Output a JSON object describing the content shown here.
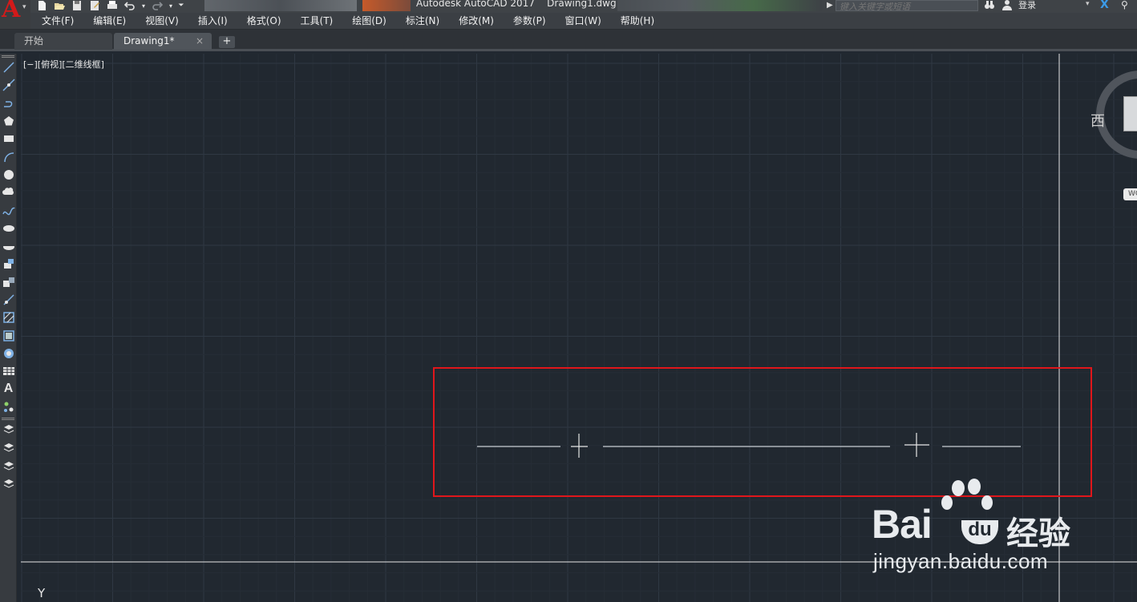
{
  "app": {
    "window_title": "Autodesk AutoCAD 2017    Drawing1.dwg",
    "search_placeholder": "键入关键字或短语",
    "login_label": "登录",
    "icons": [
      "app-logo-icon",
      "new-file-icon",
      "open-file-icon",
      "save-icon",
      "save-as-icon",
      "print-icon",
      "undo-icon",
      "redo-icon",
      "workspace-dropdown-icon",
      "binoculars-icon",
      "user-icon",
      "x-exchange-icon",
      "bookmark-icon"
    ]
  },
  "menu": {
    "items": [
      "文件(F)",
      "编辑(E)",
      "视图(V)",
      "插入(I)",
      "格式(O)",
      "工具(T)",
      "绘图(D)",
      "标注(N)",
      "修改(M)",
      "参数(P)",
      "窗口(W)",
      "帮助(H)"
    ]
  },
  "tabs": {
    "items": [
      {
        "label": "开始",
        "active": false
      },
      {
        "label": "Drawing1*",
        "active": true
      }
    ],
    "close_glyph": "×",
    "new_glyph": "+"
  },
  "toolbar": {
    "tools": [
      "line",
      "construction-line",
      "polyline",
      "polygon",
      "rectangle",
      "arc",
      "circle",
      "revision-cloud",
      "spline",
      "ellipse",
      "ellipse-arc",
      "insert-block",
      "make-block",
      "point",
      "hatch",
      "gradient",
      "region",
      "table",
      "multiline-text",
      "add-selected",
      "layer-tools-1",
      "layer-tools-2",
      "layer-tools-3",
      "layer-tools-4"
    ],
    "text_tool_label": "A"
  },
  "canvas": {
    "viewport_label": "[−][俯视][二维线框]",
    "background": "#212830",
    "viewcube": {
      "west_label": "西",
      "wcs_label": "WCS"
    },
    "ucs_y_label": "Y",
    "highlight_color": "#e0161b"
  },
  "watermark": {
    "brand": "Bai",
    "brand_du": "du",
    "product": "经验",
    "url": "jingyan.baidu.com"
  }
}
